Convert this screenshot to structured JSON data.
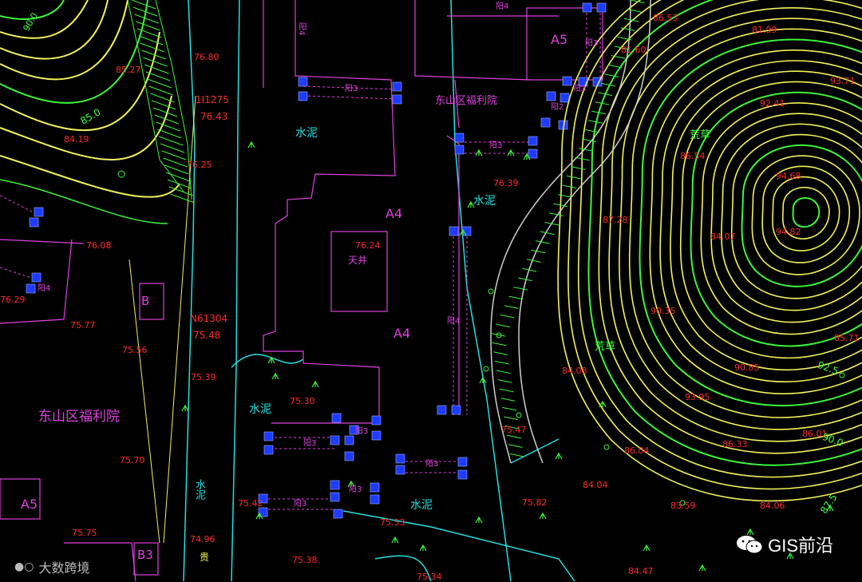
{
  "labels": {
    "water1": "水泥",
    "water2": "水泥",
    "water3": "水泥",
    "water4": "水泥",
    "welfare_top": "东山区福利院",
    "welfare_left": "东山区福利院",
    "a4_1": "A4",
    "a4_2": "A4",
    "a5_top": "A5",
    "a5_left": "A5",
    "b": "B",
    "b3": "B3",
    "tianjing": "天井",
    "road_code1": "1I1275",
    "road_code2": "N61304",
    "yang1": "阳3",
    "yang2": "阳3",
    "yang3": "阳3",
    "yang4": "阳3",
    "yang5": "阳3",
    "yang6": "阳3",
    "yang7": "阳3",
    "yang8": "阳3",
    "yang9": "阳2",
    "yang10": "阳3",
    "yang4_top": "阳4",
    "yang4_mid": "阳4",
    "yang4_right": "阳4",
    "yang4_left": "阳4",
    "green1": "荒草",
    "green2": "荒草",
    "gui": "贵"
  },
  "elevations": {
    "e1": "76.80",
    "e2": "76.43",
    "e3": "76.25",
    "e4": "76.08",
    "e5": "75.48",
    "e6": "75.39",
    "e7": "75.30",
    "e8": "75.77",
    "e9": "75.56",
    "e10": "75.70",
    "e11": "75.42",
    "e12": "75.53",
    "e13": "75.82",
    "e14": "74.96",
    "e15": "75.38",
    "e16": "75.34",
    "e17": "76.24",
    "e18": "76.39",
    "e19": "75.47",
    "e20": "76.29",
    "e21": "75.75",
    "e22": "84.19",
    "e23": "85.27",
    "e24": "81.60",
    "e25": "87.28",
    "e26": "86.54",
    "e27": "90.35",
    "e28": "90.85",
    "e29": "92.41",
    "e30": "94.68",
    "e31": "94.82",
    "e32": "81.99",
    "e33": "93.71",
    "e34": "86.53",
    "e35": "84.07",
    "e36": "84.08",
    "e37": "84.04",
    "e38": "83.59",
    "e39": "84.06",
    "e40": "86.33",
    "e41": "85.71",
    "e42": "86.04",
    "e43": "86.01",
    "e44": "84.47",
    "e45": "93.95",
    "e46": "90.0",
    "e47": "92.5",
    "e48": "87.5",
    "e49": "90.0",
    "e50": "85.0"
  },
  "watermark": {
    "brand": "GIS前沿",
    "source": "大数跨境"
  },
  "colors": {
    "contour_yellow": "#f2f25a",
    "contour_green": "#3cf53c",
    "building": "#e040e0",
    "road": "#22e0e0",
    "elevation": "#ff2b2b",
    "marker": "#1e3cff"
  }
}
